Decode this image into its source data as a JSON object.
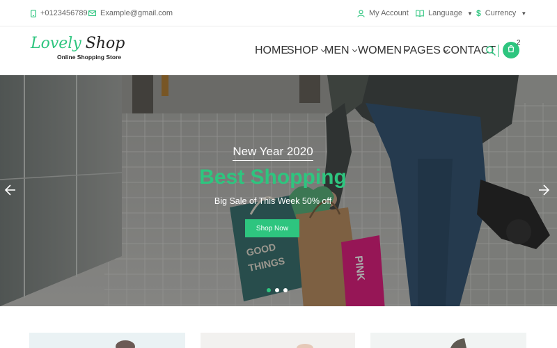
{
  "topbar": {
    "phone": "+0123456789",
    "email": "Example@gmail.com",
    "account": "My Account",
    "language": "Language",
    "currency": "Currency"
  },
  "header": {
    "logo": {
      "word1": "Lovely",
      "word2": "Shop",
      "tagline": "Online Shopping Store"
    },
    "nav": [
      {
        "label": "HOME",
        "dropdown": false
      },
      {
        "label": "SHOP",
        "dropdown": true
      },
      {
        "label": "MEN",
        "dropdown": true
      },
      {
        "label": "WOMEN",
        "dropdown": true
      },
      {
        "label": "PAGES",
        "dropdown": true
      },
      {
        "label": "CONTACT",
        "dropdown": false
      }
    ],
    "cart_count": "2"
  },
  "hero": {
    "pretitle": "New Year 2020",
    "title": "Best Shopping",
    "subtitle": "Big Sale of This Week 50% off",
    "cta": "Shop Now",
    "slides": 3,
    "active_slide": 1
  },
  "colors": {
    "accent": "#2ec57f",
    "text": "#333333",
    "bag_pink": "#e0127a",
    "bag_kraft": "#b8895a",
    "bag_teal": "#2f6b6a"
  }
}
